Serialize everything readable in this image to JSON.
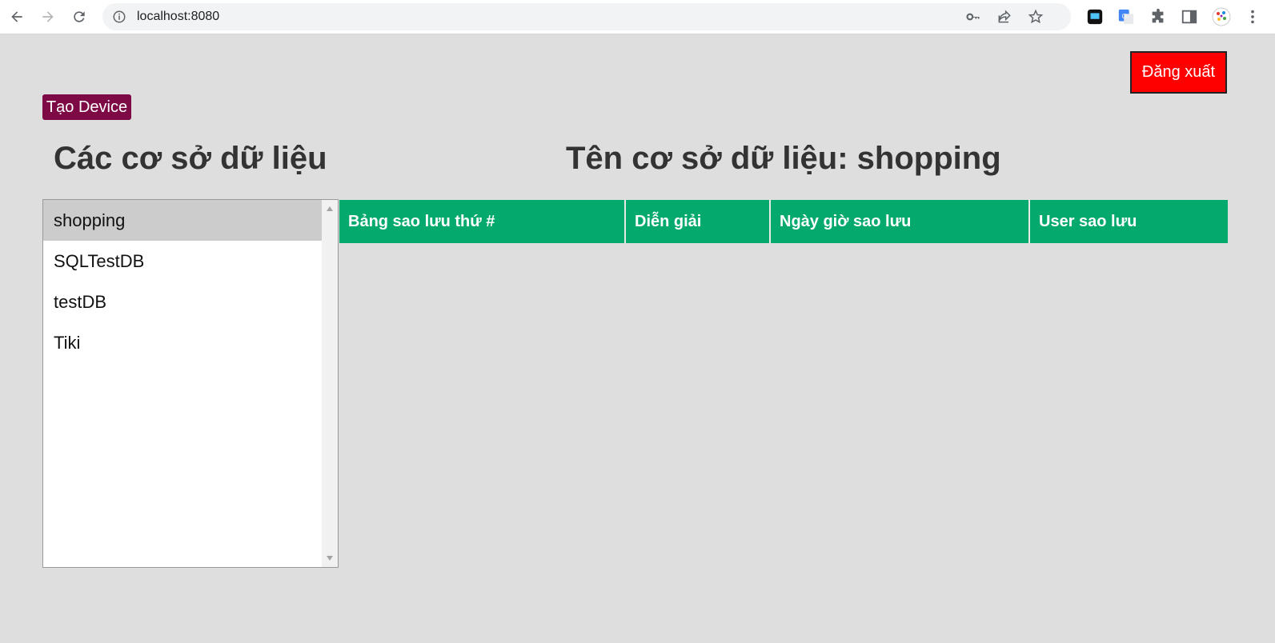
{
  "browser": {
    "url": "localhost:8080"
  },
  "header": {
    "logout_label": "Đăng xuất",
    "create_device_label": "Tạo Device"
  },
  "sidebar": {
    "title": "Các cơ sở dữ liệu",
    "databases": [
      {
        "name": "shopping",
        "selected": true
      },
      {
        "name": "SQLTestDB",
        "selected": false
      },
      {
        "name": "testDB",
        "selected": false
      },
      {
        "name": "Tiki",
        "selected": false
      }
    ]
  },
  "main": {
    "title": "Tên cơ sở dữ liệu: shopping",
    "table": {
      "columns": [
        "Bảng sao lưu thứ #",
        "Diễn giải",
        "Ngày giờ sao lưu",
        "User sao lưu"
      ],
      "rows": []
    }
  },
  "colors": {
    "page_background": "#dedede",
    "logout_button": "#ff0000",
    "create_button": "#7d0a45",
    "table_header": "#04aa6d",
    "selected_item": "#cccccc"
  }
}
